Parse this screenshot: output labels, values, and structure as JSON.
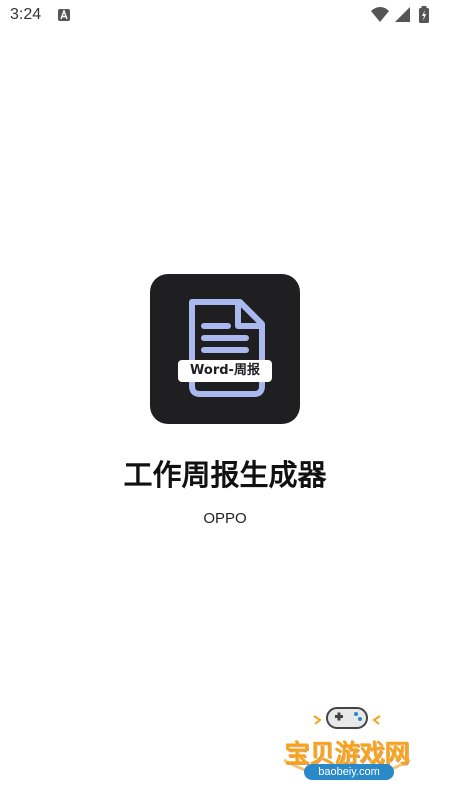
{
  "status_bar": {
    "time": "3:24",
    "icons": [
      "notification-a-icon",
      "wifi-icon",
      "signal-icon",
      "battery-icon"
    ]
  },
  "splash": {
    "icon_badge": "Word-周报",
    "app_name": "工作周报生成器",
    "publisher": "OPPO"
  },
  "watermark": {
    "text": "宝贝游戏网",
    "url": "baobeiy.com"
  },
  "colors": {
    "icon_bg": "#1f1f22",
    "icon_doc": "#a9b8ef",
    "watermark_orange": "#f7a21c",
    "watermark_blue": "#2a89c8"
  }
}
